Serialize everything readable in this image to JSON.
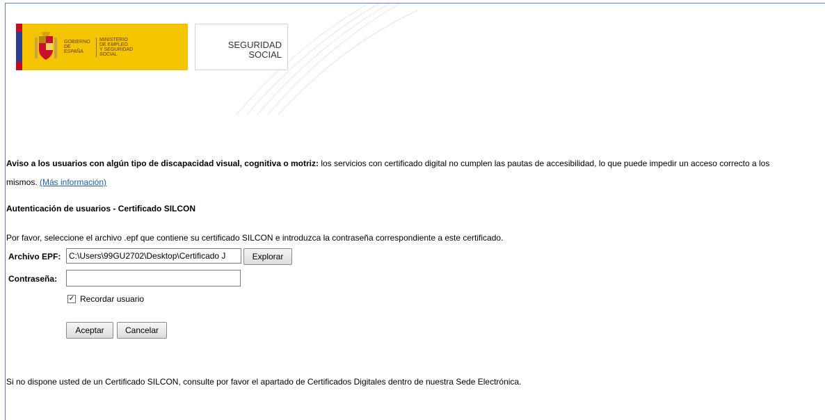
{
  "header": {
    "gov_logo": {
      "line1": "GOBIERNO",
      "line2": "DE ESPAÑA",
      "ministry1": "MINISTERIO",
      "ministry2": "DE EMPLEO",
      "ministry3": "Y SEGURIDAD SOCIAL"
    },
    "ss_logo": {
      "line1": "SEGURIDAD",
      "line2": "SOCIAL"
    }
  },
  "notice": {
    "bold": "Aviso a los usuarios con algún tipo de discapacidad visual, cognitiva o motriz:",
    "text": " los servicios con certificado digital no cumplen las pautas de accesibilidad, lo que puede impedir un acceso correcto a los",
    "text2": "mismos. ",
    "link": "(Más información)"
  },
  "auth": {
    "heading": "Autenticación de usuarios - Certificado SILCON",
    "intro": "Por favor, seleccione el archivo .epf que contiene su certificado SILCON e introduzca la contraseña correspondiente a este certificado.",
    "file_label": "Archivo EPF:",
    "file_value": "C:\\Users\\99GU2702\\Desktop\\Certificado J",
    "explore_label": "Explorar",
    "password_label": "Contraseña:",
    "password_value": "",
    "remember_label": "Recordar usuario",
    "remember_checked": true,
    "accept_label": "Aceptar",
    "cancel_label": "Cancelar"
  },
  "footer": {
    "text": "Si no dispone usted de un Certificado SILCON, consulte por favor el apartado de Certificados Digitales dentro de nuestra Sede Electrónica."
  },
  "colors": {
    "gov_yellow": "#f4c400",
    "link_blue": "#1f5db3"
  }
}
